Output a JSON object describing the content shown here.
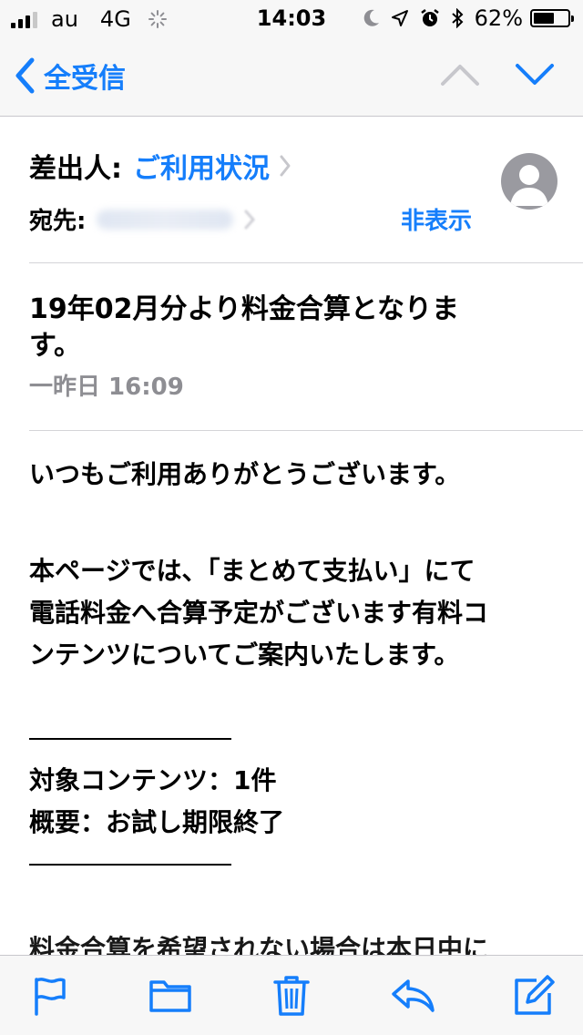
{
  "status_bar": {
    "carrier": "au",
    "network": "4G",
    "time": "14:03",
    "battery_percent": "62%",
    "battery_level": 0.62
  },
  "nav": {
    "back_label": "全受信"
  },
  "header": {
    "from_label": "差出人:",
    "from_name": "ご利用状況",
    "to_label": "宛先:",
    "hide_label": "非表示"
  },
  "message": {
    "subject": "19年02月分より料金合算となります。",
    "date": "一昨日 16:09",
    "body": {
      "greeting": "いつもご利用ありがとうございます。",
      "intro_1": "本ページでは、「まとめて支払い」にて",
      "intro_2": "電話料金へ合算予定がございます有料コ",
      "intro_3": "ンテンツについてご案内いたします。",
      "target_contents": "対象コンテンツ：1件",
      "summary": "概要：お試し期限終了",
      "peek_line": "料金合算を希望されない場合は本日中に"
    }
  },
  "colors": {
    "accent": "#157efb",
    "gray_text": "#8e8e93",
    "bar_bg": "#f7f7f7"
  },
  "toolbar": {
    "icons": [
      "flag-icon",
      "folder-icon",
      "trash-icon",
      "reply-icon",
      "compose-icon"
    ]
  }
}
